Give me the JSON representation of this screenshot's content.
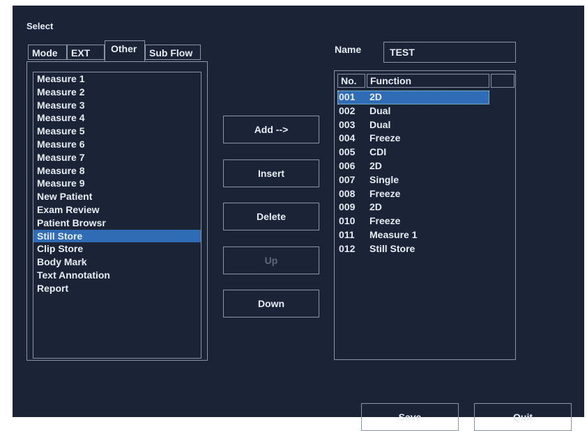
{
  "title": "Select",
  "tabs": [
    {
      "label": "Mode"
    },
    {
      "label": "EXT"
    },
    {
      "label": "Other"
    },
    {
      "label": "Sub Flow"
    }
  ],
  "active_tab": "Other",
  "left_list": [
    "Measure 1",
    "Measure 2",
    "Measure 3",
    "Measure 4",
    "Measure 5",
    "Measure 6",
    "Measure 7",
    "Measure 8",
    "Measure 9",
    "New Patient",
    "Exam Review",
    "Patient Browsr",
    "Still Store",
    "Clip Store",
    "Body Mark",
    "Text Annotation",
    "Report"
  ],
  "left_selected": "Still Store",
  "buttons": {
    "add": "Add -->",
    "insert": "Insert",
    "delete": "Delete",
    "up": "Up",
    "down": "Down",
    "save": "Save",
    "quit": "Quit"
  },
  "name": {
    "label": "Name",
    "value": "TEST"
  },
  "table": {
    "headers": [
      "No.",
      "Function",
      ""
    ],
    "rows": [
      {
        "no": "001",
        "function": "2D"
      },
      {
        "no": "002",
        "function": "Dual"
      },
      {
        "no": "003",
        "function": "Dual"
      },
      {
        "no": "004",
        "function": "Freeze"
      },
      {
        "no": "005",
        "function": "CDI"
      },
      {
        "no": "006",
        "function": "2D"
      },
      {
        "no": "007",
        "function": "Single"
      },
      {
        "no": "008",
        "function": "Freeze"
      },
      {
        "no": "009",
        "function": "2D"
      },
      {
        "no": "010",
        "function": "Freeze"
      },
      {
        "no": "011",
        "function": "Measure 1"
      },
      {
        "no": "012",
        "function": "Still Store"
      }
    ],
    "selected_row": "001"
  },
  "colors": {
    "background": "#1a2436",
    "selection": "#2f6cb5",
    "border": "#8a96a8",
    "disabled_text": "#5d6a7d"
  }
}
